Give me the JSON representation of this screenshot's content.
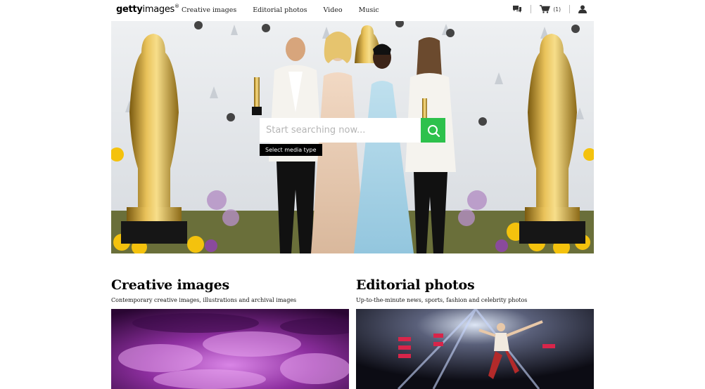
{
  "header": {
    "logo_bold": "getty",
    "logo_rest": "images",
    "logo_reg": "®",
    "nav": [
      {
        "label": "Creative images"
      },
      {
        "label": "Editorial photos"
      },
      {
        "label": "Video"
      },
      {
        "label": "Music"
      }
    ],
    "icons": [
      "chat-icon",
      "cart-icon",
      "user-icon"
    ],
    "cart_count": "(1)"
  },
  "hero": {
    "search_placeholder": "Start searching now...",
    "search_value": "",
    "media_type_label": "Select media type",
    "search_button_icon": "search-icon",
    "accent_color": "#2dc14c"
  },
  "sections": [
    {
      "title": "Creative images",
      "subtitle": "Contemporary creative images, illustrations and archival images"
    },
    {
      "title": "Editorial photos",
      "subtitle": "Up-to-the-minute news, sports, fashion and celebrity photos"
    }
  ]
}
